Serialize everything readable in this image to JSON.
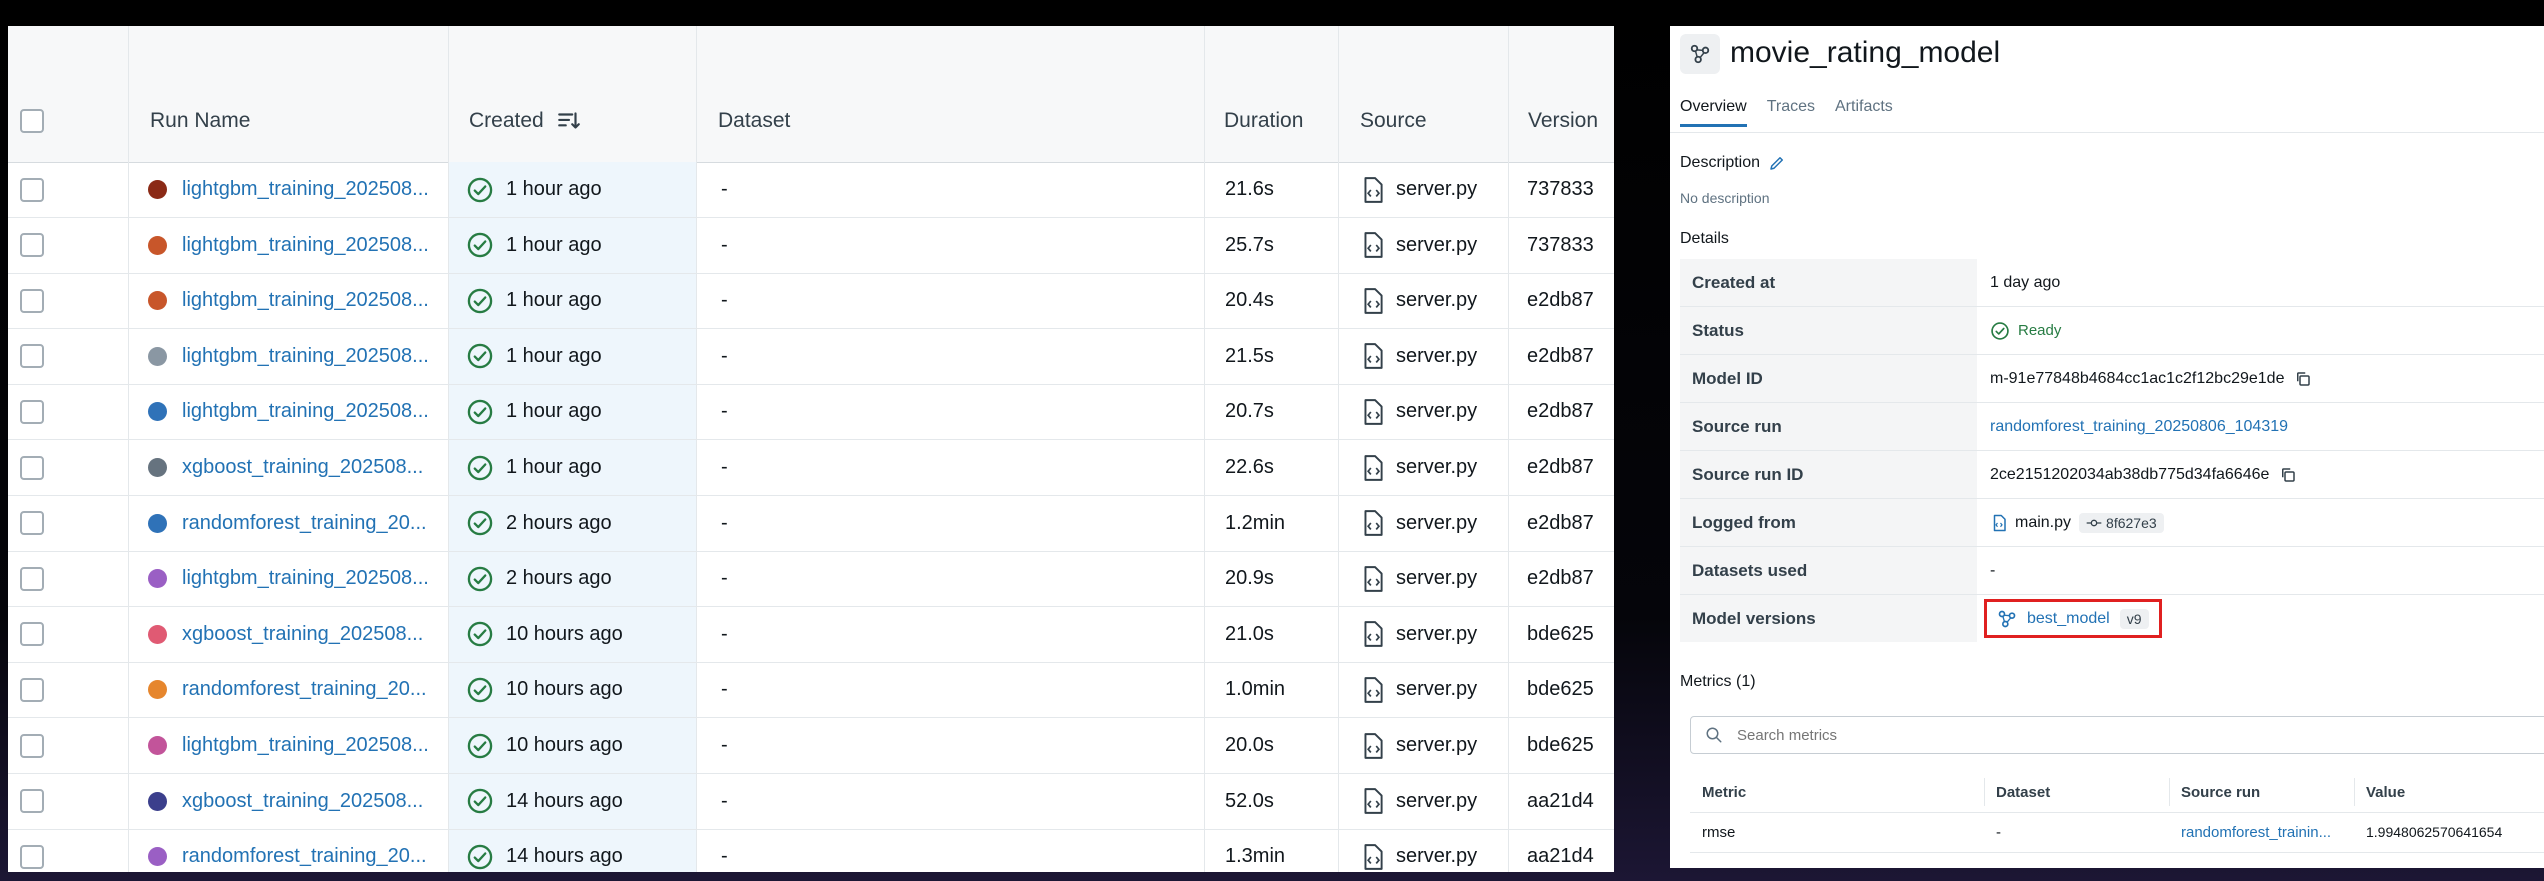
{
  "runs_table": {
    "columns": {
      "run_name": "Run Name",
      "created": "Created",
      "dataset": "Dataset",
      "duration": "Duration",
      "source": "Source",
      "version": "Version"
    },
    "rows": [
      {
        "color": "#8b2a16",
        "name": "lightgbm_training_202508...",
        "created": "1 hour ago",
        "dataset": "-",
        "duration": "21.6s",
        "source": "server.py",
        "version": "737833"
      },
      {
        "color": "#c8562a",
        "name": "lightgbm_training_202508...",
        "created": "1 hour ago",
        "dataset": "-",
        "duration": "25.7s",
        "source": "server.py",
        "version": "737833"
      },
      {
        "color": "#c8562a",
        "name": "lightgbm_training_202508...",
        "created": "1 hour ago",
        "dataset": "-",
        "duration": "20.4s",
        "source": "server.py",
        "version": "e2db87"
      },
      {
        "color": "#8a97a3",
        "name": "lightgbm_training_202508...",
        "created": "1 hour ago",
        "dataset": "-",
        "duration": "21.5s",
        "source": "server.py",
        "version": "e2db87"
      },
      {
        "color": "#2f72b8",
        "name": "lightgbm_training_202508...",
        "created": "1 hour ago",
        "dataset": "-",
        "duration": "20.7s",
        "source": "server.py",
        "version": "e2db87"
      },
      {
        "color": "#66737f",
        "name": "xgboost_training_202508...",
        "created": "1 hour ago",
        "dataset": "-",
        "duration": "22.6s",
        "source": "server.py",
        "version": "e2db87"
      },
      {
        "color": "#2f72b8",
        "name": "randomforest_training_20...",
        "created": "2 hours ago",
        "dataset": "-",
        "duration": "1.2min",
        "source": "server.py",
        "version": "e2db87"
      },
      {
        "color": "#9a5fc4",
        "name": "lightgbm_training_202508...",
        "created": "2 hours ago",
        "dataset": "-",
        "duration": "20.9s",
        "source": "server.py",
        "version": "e2db87"
      },
      {
        "color": "#e05a73",
        "name": "xgboost_training_202508...",
        "created": "10 hours ago",
        "dataset": "-",
        "duration": "21.0s",
        "source": "server.py",
        "version": "bde625"
      },
      {
        "color": "#e6862d",
        "name": "randomforest_training_20...",
        "created": "10 hours ago",
        "dataset": "-",
        "duration": "1.0min",
        "source": "server.py",
        "version": "bde625"
      },
      {
        "color": "#c2549a",
        "name": "lightgbm_training_202508...",
        "created": "10 hours ago",
        "dataset": "-",
        "duration": "20.0s",
        "source": "server.py",
        "version": "bde625"
      },
      {
        "color": "#3b3f8c",
        "name": "xgboost_training_202508...",
        "created": "14 hours ago",
        "dataset": "-",
        "duration": "52.0s",
        "source": "server.py",
        "version": "aa21d4"
      },
      {
        "color": "#9a5fc4",
        "name": "randomforest_training_20...",
        "created": "14 hours ago",
        "dataset": "-",
        "duration": "1.3min",
        "source": "server.py",
        "version": "aa21d4"
      }
    ]
  },
  "model": {
    "title": "movie_rating_model",
    "tabs": [
      "Overview",
      "Traces",
      "Artifacts"
    ],
    "description_label": "Description",
    "description_value": "No description",
    "details_label": "Details",
    "details": {
      "created_at": {
        "label": "Created at",
        "value": "1 day ago"
      },
      "status": {
        "label": "Status",
        "value": "Ready"
      },
      "model_id": {
        "label": "Model ID",
        "value": "m-91e77848b4684cc1ac1c2f12bc29e1de"
      },
      "source_run": {
        "label": "Source run",
        "value": "randomforest_training_20250806_104319"
      },
      "source_run_id": {
        "label": "Source run ID",
        "value": "2ce2151202034ab38db775d34fa6646e"
      },
      "logged_from": {
        "label": "Logged from",
        "value": "main.py",
        "commit": "8f627e3"
      },
      "datasets_used": {
        "label": "Datasets used",
        "value": "-"
      },
      "model_versions": {
        "label": "Model versions",
        "value": "best_model",
        "version": "v9"
      }
    },
    "metrics": {
      "heading": "Metrics (1)",
      "search_placeholder": "Search metrics",
      "columns": [
        "Metric",
        "Dataset",
        "Source run",
        "Value"
      ],
      "rows": [
        {
          "metric": "rmse",
          "dataset": "-",
          "source_run": "randomforest_trainin...",
          "value": "1.9948062570641654"
        }
      ]
    }
  },
  "colors": {
    "link": "#2272b4",
    "success": "#277c43",
    "highlight": "#e02020"
  }
}
